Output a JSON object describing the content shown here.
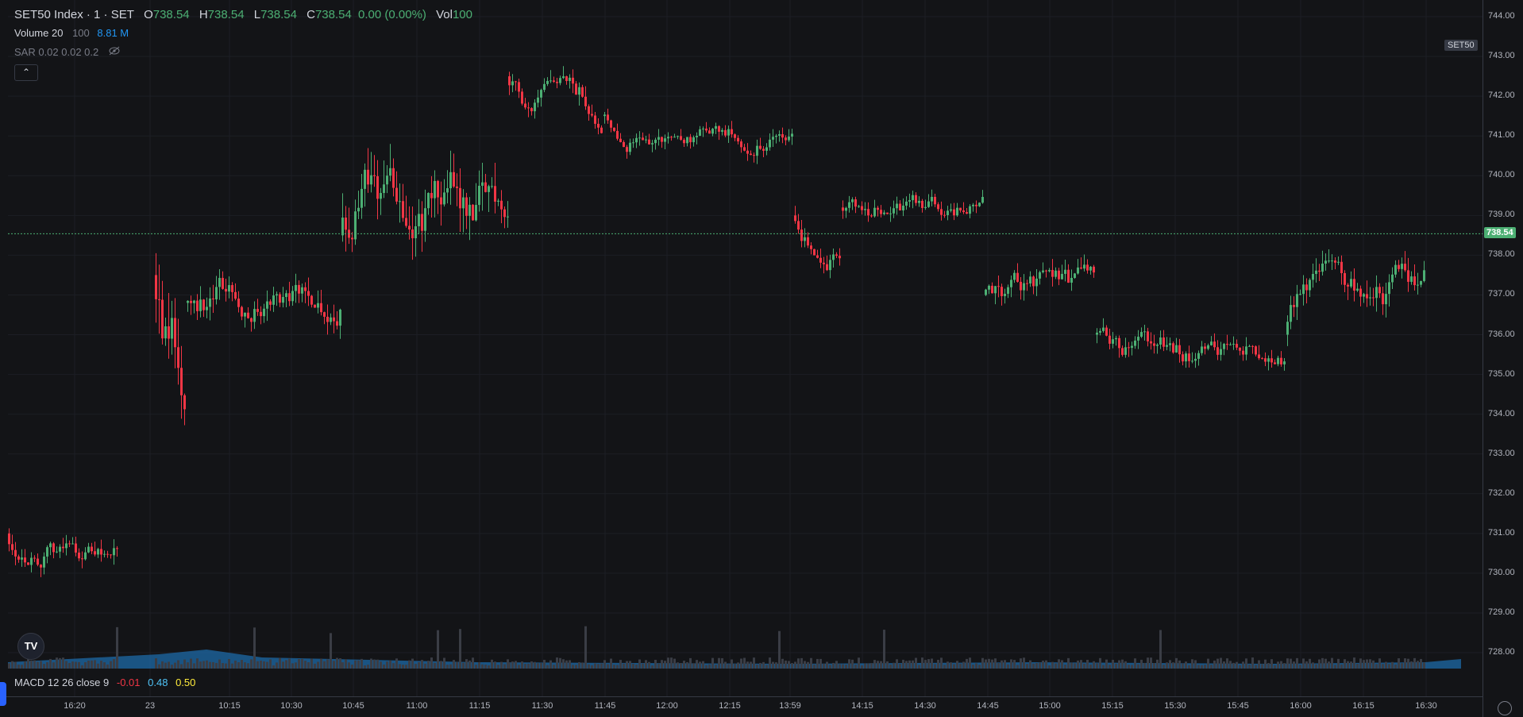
{
  "legend": {
    "symbol": "SET50 Index · 1 · SET",
    "open_key": "O",
    "open": "738.54",
    "high_key": "H",
    "high": "738.54",
    "low_key": "L",
    "low": "738.54",
    "close_key": "C",
    "close": "738.54",
    "change": "0.00 (0.00%)",
    "vol_key": "Vol",
    "vol": "100",
    "volume_name": "Volume 20",
    "volume_param": "100",
    "volume_value": "8.81 M",
    "sar": "SAR 0.02 0.02 0.2",
    "collapse_icon": "chevron-up-icon",
    "eye_icon": "eye-off-icon"
  },
  "badges": {
    "symbol": "SET50",
    "last_price": "738.54"
  },
  "price_axis": [
    "744.00",
    "743.00",
    "742.00",
    "741.00",
    "740.00",
    "739.00",
    "738.00",
    "737.00",
    "736.00",
    "735.00",
    "734.00",
    "733.00",
    "732.00",
    "731.00",
    "730.00",
    "729.00",
    "728.00"
  ],
  "time_axis": [
    "16:20",
    "23",
    "10:15",
    "10:30",
    "10:45",
    "11:00",
    "11:15",
    "11:30",
    "11:45",
    "12:00",
    "12:15",
    "13:59",
    "14:15",
    "14:30",
    "14:45",
    "15:00",
    "15:15",
    "15:30",
    "15:45",
    "16:00",
    "16:15",
    "16:30"
  ],
  "macd": {
    "label": "MACD 12 26 close 9",
    "v1": "-0.01",
    "v2": "0.48",
    "v3": "0.50"
  },
  "colors": {
    "up": "#4caf73",
    "down": "#f23645",
    "volume": "#1e6aa8",
    "macd1": "#f23645",
    "macd2": "#4fc3f7",
    "macd3": "#ffeb3b"
  },
  "chart_data": {
    "type": "candlestick",
    "ylim": [
      727.6,
      744.3
    ],
    "last_price": 738.54,
    "segments": [
      {
        "x0": 10,
        "x1": 150,
        "start": 731.0,
        "mean": 730.6,
        "amp": 0.7
      },
      {
        "x0": 195,
        "x1": 235,
        "start": 737.5,
        "mean": 735.0,
        "amp": 2.5
      },
      {
        "x0": 235,
        "x1": 430,
        "start": 736.8,
        "mean": 737.0,
        "amp": 1.0
      },
      {
        "x0": 430,
        "x1": 640,
        "start": 738.5,
        "mean": 739.5,
        "amp": 1.8
      },
      {
        "x0": 640,
        "x1": 760,
        "start": 742.5,
        "mean": 741.7,
        "amp": 0.8
      },
      {
        "x0": 760,
        "x1": 1000,
        "start": 741.5,
        "mean": 741.0,
        "amp": 0.6
      },
      {
        "x0": 1000,
        "x1": 1060,
        "start": 739.0,
        "mean": 738.0,
        "amp": 0.7
      },
      {
        "x0": 1060,
        "x1": 1240,
        "start": 739.2,
        "mean": 739.2,
        "amp": 0.6
      },
      {
        "x0": 1240,
        "x1": 1380,
        "start": 737.0,
        "mean": 737.0,
        "amp": 0.8
      },
      {
        "x0": 1380,
        "x1": 1620,
        "start": 736.0,
        "mean": 735.6,
        "amp": 0.7
      },
      {
        "x0": 1620,
        "x1": 1795,
        "start": 736.0,
        "mean": 737.2,
        "amp": 1.0
      }
    ]
  }
}
